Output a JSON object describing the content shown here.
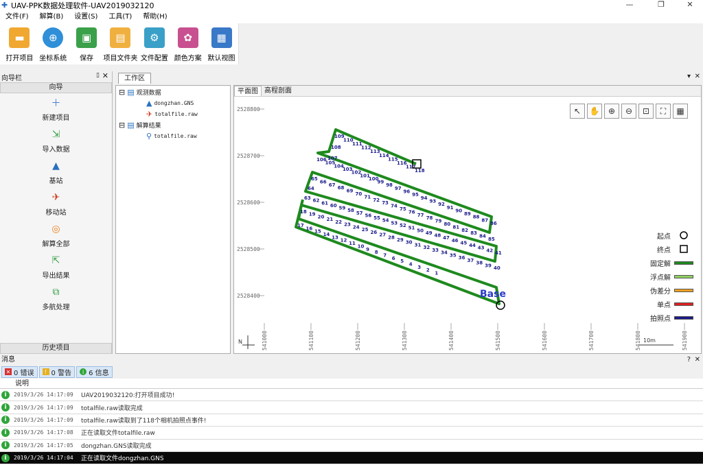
{
  "window": {
    "title": "UAV-PPK数据处理软件-UAV2019032120",
    "controls": [
      "—",
      "❐",
      "✕"
    ]
  },
  "menu": [
    "文件(F)",
    "解算(B)",
    "设置(S)",
    "工具(T)",
    "帮助(H)"
  ],
  "toolbar": [
    {
      "label": "打开项目",
      "icon": "folder-open-icon",
      "color": "#f0a830"
    },
    {
      "label": "坐标系统",
      "icon": "globe-icon",
      "color": "#2f8fd8"
    },
    {
      "label": "保存",
      "icon": "save-icon",
      "color": "#3aa04a"
    },
    {
      "label": "项目文件夹",
      "icon": "project-folder-icon",
      "color": "#f0b040"
    },
    {
      "label": "文件配置",
      "icon": "file-config-icon",
      "color": "#3aa0c8"
    },
    {
      "label": "颜色方案",
      "icon": "palette-icon",
      "color": "#c85090"
    },
    {
      "label": "默认视图",
      "icon": "default-view-icon",
      "color": "#3a78c8"
    }
  ],
  "nav": {
    "panel_title": "向导栏",
    "header": "向导",
    "items": [
      {
        "label": "新建项目",
        "icon": "new-project-icon",
        "glyph": "＋",
        "color": "#4a80d0"
      },
      {
        "label": "导入数据",
        "icon": "import-data-icon",
        "glyph": "⇲",
        "color": "#3aa04a"
      },
      {
        "label": "基站",
        "icon": "base-station-icon",
        "glyph": "▲",
        "color": "#2a70c0"
      },
      {
        "label": "移动站",
        "icon": "rover-icon",
        "glyph": "✈",
        "color": "#d04020"
      },
      {
        "label": "解算全部",
        "icon": "solve-all-icon",
        "glyph": "◎",
        "color": "#f08020"
      },
      {
        "label": "导出结果",
        "icon": "export-results-icon",
        "glyph": "⇱",
        "color": "#3aa04a"
      },
      {
        "label": "多航处理",
        "icon": "multi-flight-icon",
        "glyph": "⧉",
        "color": "#3aa04a"
      }
    ],
    "footer": "历史项目"
  },
  "work": {
    "tab": "工作区",
    "tree": {
      "raw_data": "观测数据",
      "raw_files": [
        "dongzhan.GNS",
        "totalfile.raw"
      ],
      "results": "解算结果",
      "result_files": [
        "totalfile.raw"
      ]
    },
    "map_tabs": [
      "平面图",
      "高程剖面"
    ],
    "y_ticks": [
      "2528800",
      "2528700",
      "2528600",
      "2528500",
      "2528400"
    ],
    "x_ticks": [
      "541000",
      "541100",
      "541200",
      "541300",
      "541400",
      "541500",
      "541600",
      "541700",
      "541800",
      "541900"
    ],
    "scale_bar": "10m",
    "north_label": "N",
    "base_label": "Base",
    "legend": [
      {
        "label": "起点",
        "shape": "circle"
      },
      {
        "label": "终点",
        "shape": "square"
      },
      {
        "label": "固定解",
        "color": "#1e8a1e"
      },
      {
        "label": "浮点解",
        "color": "#90d060"
      },
      {
        "label": "伪差分",
        "color": "#f0a020"
      },
      {
        "label": "单点",
        "color": "#e02020"
      },
      {
        "label": "拍照点",
        "color": "#1a1a8a"
      }
    ],
    "map_tools": [
      "cursor-icon",
      "pan-hand-icon",
      "zoom-in-icon",
      "zoom-out-icon",
      "zoom-box-icon",
      "zoom-extent-icon",
      "grid-icon"
    ]
  },
  "messages": {
    "panel_title": "消息",
    "filters": [
      {
        "label": "0 错误",
        "icon": "error-icon",
        "color": "#d83030"
      },
      {
        "label": "0 警告",
        "icon": "warning-icon",
        "color": "#e8b020"
      },
      {
        "label": "6 信息",
        "icon": "info-icon",
        "color": "#2fa53a"
      }
    ],
    "column": "说明",
    "rows": [
      {
        "time": "2019/3/26 14:17:09",
        "text": "UAV2019032120:打开项目成功!"
      },
      {
        "time": "2019/3/26 14:17:09",
        "text": "totalfile.raw读取完成"
      },
      {
        "time": "2019/3/26 14:17:09",
        "text": "totalfile.raw读取到了118个相机拍照点事件!"
      },
      {
        "time": "2019/3/26 14:17:08",
        "text": "正在读取文件totalfile.raw"
      },
      {
        "time": "2019/3/26 14:17:05",
        "text": "dongzhan.GNS读取完成"
      },
      {
        "time": "2019/3/26 14:17:04",
        "text": "正在读取文件dongzhan.GNS"
      }
    ]
  }
}
